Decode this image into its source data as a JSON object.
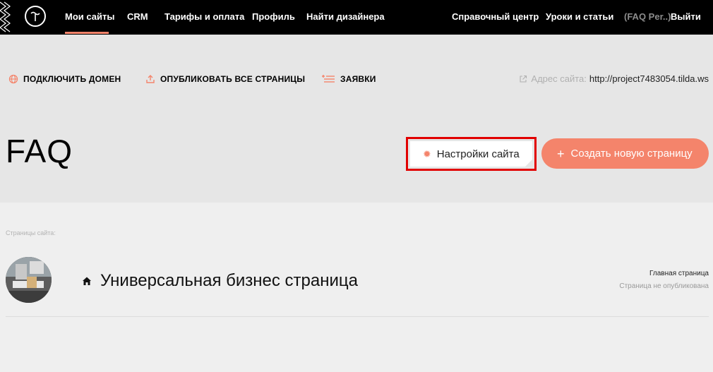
{
  "topnav": {
    "left": [
      "Мои сайты",
      "CRM",
      "Тарифы и оплата",
      "Профиль",
      "Найти дизайнера"
    ],
    "right": [
      "Справочный центр",
      "Уроки и статьи"
    ],
    "account": "(FAQ Per..)",
    "logout": "Выйти",
    "accent": "#f4846b"
  },
  "toolbar": {
    "connect_domain": "ПОДКЛЮЧИТЬ ДОМЕН",
    "publish_all": "ОПУБЛИКОВАТЬ ВСЕ СТРАНИЦЫ",
    "requests": "ЗАЯВКИ",
    "address_label": "Адрес сайта:",
    "address_value": "http://project7483054.tilda.ws"
  },
  "project": {
    "title": "FAQ",
    "settings_label": "Настройки сайта",
    "create_label": "Создать новую страницу"
  },
  "pages": {
    "section_label": "Страницы сайта:",
    "items": [
      {
        "title": "Универсальная бизнес страница",
        "meta_main": "Главная страница",
        "meta_status": "Страница не опубликована"
      }
    ]
  },
  "colors": {
    "accent": "#f4846b",
    "highlight_border": "#e10000"
  }
}
